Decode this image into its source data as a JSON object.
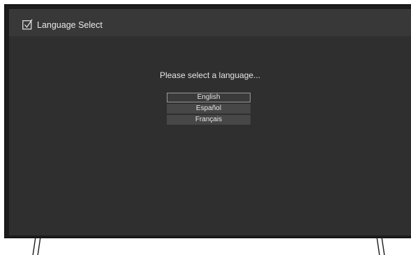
{
  "header": {
    "icon": "checkbox-checked-icon",
    "title": "Language Select"
  },
  "prompt": "Please select a language...",
  "languages": [
    {
      "label": "English",
      "selected": true
    },
    {
      "label": "Español",
      "selected": false
    },
    {
      "label": "Français",
      "selected": false
    }
  ],
  "colors": {
    "screen_background": "#2f2f2f",
    "header_background": "#383838",
    "option_background": "#474747",
    "selected_border": "#9a9a9a",
    "text": "#e6e6e6"
  }
}
